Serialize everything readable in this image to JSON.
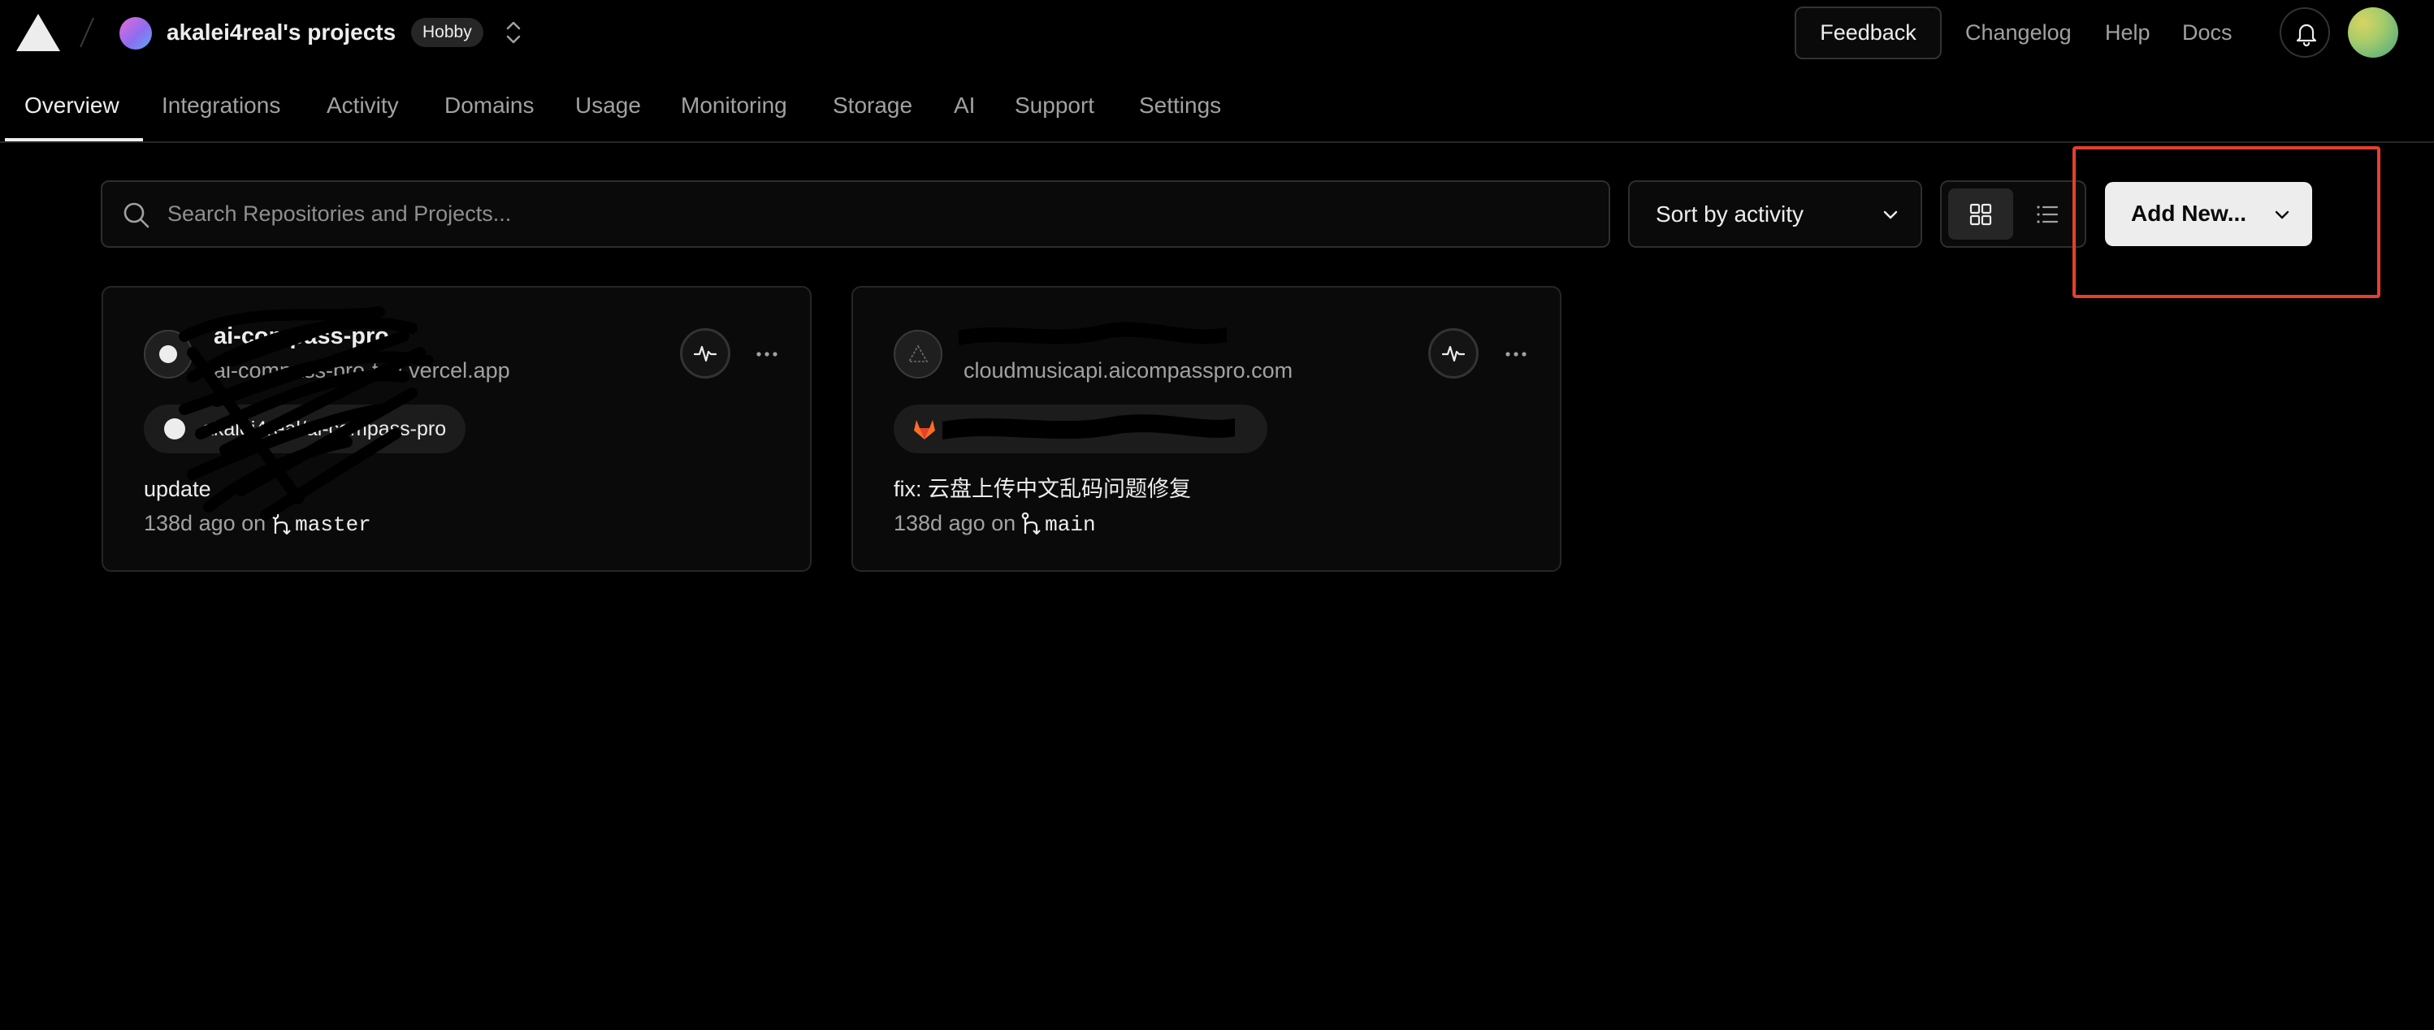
{
  "header": {
    "team_name": "akalei4real's projects",
    "plan_badge": "Hobby",
    "feedback_label": "Feedback",
    "links": [
      "Changelog",
      "Help",
      "Docs"
    ]
  },
  "tabs": [
    {
      "label": "Overview",
      "active": true
    },
    {
      "label": "Integrations"
    },
    {
      "label": "Activity"
    },
    {
      "label": "Domains"
    },
    {
      "label": "Usage"
    },
    {
      "label": "Monitoring"
    },
    {
      "label": "Storage"
    },
    {
      "label": "AI"
    },
    {
      "label": "Support"
    },
    {
      "label": "Settings"
    }
  ],
  "toolbar": {
    "search_placeholder": "Search Repositories and Projects...",
    "sort_label": "Sort by activity",
    "add_new_label": "Add New..."
  },
  "projects": [
    {
      "name": "ai-compass-pro",
      "domain": "ai-compass-pro-tau.vercel.app",
      "repo": "akalei4real/ai-compass-pro",
      "commit_message": "update",
      "commit_time": "138d ago on",
      "branch": "master"
    },
    {
      "name": "",
      "domain": "cloudmusicapi.aicompasspro.com",
      "repo": "",
      "commit_message": "fix: 云盘上传中文乱码问题修复",
      "commit_time": "138d ago on",
      "branch": "main"
    }
  ],
  "colors": {
    "background": "#000000",
    "accent_highlight": "#e5402e",
    "primary_button": "#ededed",
    "gitlab_orange": "#fc6d26"
  }
}
